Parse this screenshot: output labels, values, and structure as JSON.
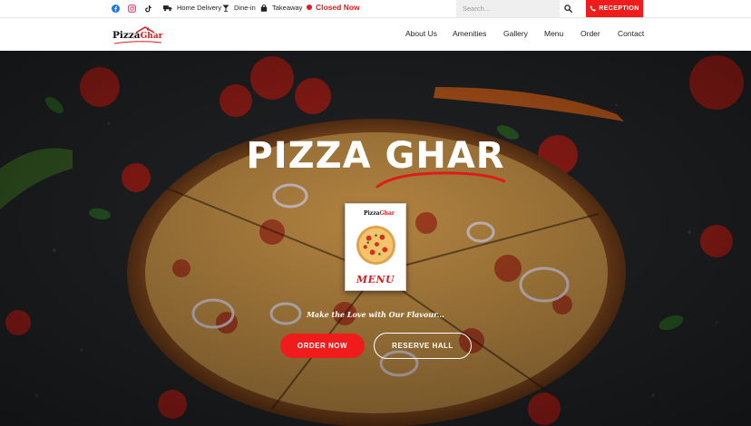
{
  "topbar": {
    "social": [
      "facebook-icon",
      "instagram-icon",
      "tiktok-icon"
    ],
    "services": {
      "home_delivery": "Home Delivery",
      "dine_in": "Dine-in",
      "takeaway": "Takeaway"
    },
    "status": "Closed Now",
    "search_placeholder": "Search...",
    "reception_label": "RECEPTION"
  },
  "nav": {
    "logo_part1": "Pizza",
    "logo_part2": "Ghar",
    "items": [
      "About Us",
      "Amenities",
      "Gallery",
      "Menu",
      "Order",
      "Contact"
    ]
  },
  "hero": {
    "title": "PIZZA GHAR",
    "menu_card": {
      "logo_part1": "Pizza",
      "logo_part2": "Ghar",
      "label": "MENU"
    },
    "tagline": "Make the Love with Our Flavour...",
    "order_button": "ORDER NOW",
    "reserve_button": "RESERVE HALL"
  },
  "colors": {
    "accent": "#f01c1c",
    "status_red": "#e01b1b",
    "hero_dark": "#1d1f21"
  }
}
